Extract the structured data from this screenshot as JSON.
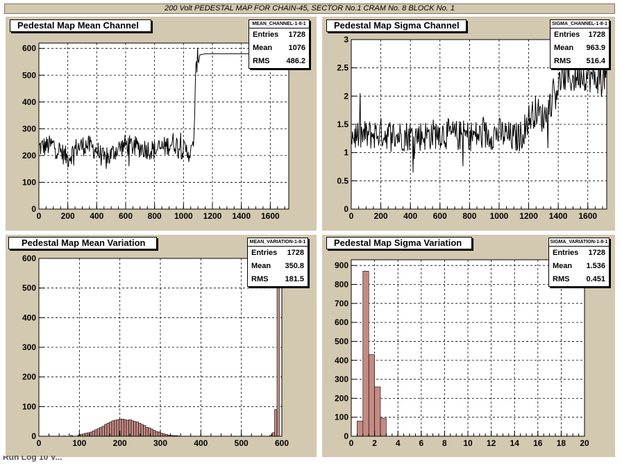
{
  "header": {
    "title": "200 Volt PEDESTAL MAP FOR CHAIN-45, SECTOR No.1 CRAM No. 8 BLOCK No. 1"
  },
  "footer": {
    "text": "Run Log 10 V..."
  },
  "colors": {
    "pad": "#d3c8b0",
    "hist_fill": "#c48b84",
    "line": "#000000"
  },
  "chart_data": [
    {
      "type": "line",
      "title": "Pedestal Map Mean Channel",
      "stats": {
        "name": "MEAN_CHANNEL-1-8-1",
        "Entries": "1728",
        "Mean": "1076",
        "RMS": "486.2"
      },
      "xlim": [
        0,
        1728
      ],
      "ylim": [
        0,
        620
      ],
      "xticks": [
        0,
        200,
        400,
        600,
        800,
        1000,
        1200,
        1400,
        1600
      ],
      "yticks": [
        0,
        100,
        200,
        300,
        400,
        500,
        600
      ],
      "grid": true,
      "series": [
        {
          "x": [
            0,
            100,
            200,
            260,
            330,
            400,
            460,
            530,
            600,
            700,
            800,
            860,
            930,
            1000,
            1060,
            1075,
            1085,
            1095,
            1105,
            1150,
            1300,
            1400,
            1500,
            1600,
            1728
          ],
          "y": [
            230,
            240,
            190,
            230,
            240,
            220,
            180,
            220,
            240,
            230,
            220,
            230,
            250,
            220,
            210,
            300,
            500,
            560,
            575,
            580,
            580,
            580,
            580,
            580,
            580
          ]
        }
      ]
    },
    {
      "type": "line",
      "title": "Pedestal Map Sigma Channel",
      "stats": {
        "name": "SIGMA_CHANNEL-1-8-1",
        "Entries": "1728",
        "Mean": "963.9",
        "RMS": "516.4"
      },
      "xlim": [
        0,
        1728
      ],
      "ylim": [
        0,
        3
      ],
      "xticks": [
        0,
        200,
        400,
        600,
        800,
        1000,
        1200,
        1400,
        1600
      ],
      "yticks": [
        0,
        0.5,
        1,
        1.5,
        2,
        2.5,
        3
      ],
      "ytick_labels": [
        "0",
        "0.5",
        "1",
        "1.5",
        "2",
        "2.5",
        "3"
      ],
      "grid": true,
      "series": [
        {
          "x": [
            0,
            100,
            200,
            300,
            400,
            500,
            600,
            700,
            800,
            900,
            1000,
            1100,
            1150,
            1200,
            1250,
            1300,
            1350,
            1400,
            1450,
            1500,
            1550,
            1600,
            1650,
            1728
          ],
          "y": [
            1.3,
            1.3,
            1.35,
            1.3,
            1.3,
            1.3,
            1.35,
            1.3,
            1.3,
            1.3,
            1.35,
            1.25,
            1.3,
            1.6,
            1.75,
            1.6,
            1.9,
            2.2,
            2.35,
            2.3,
            2.4,
            2.35,
            2.3,
            2.35
          ]
        }
      ]
    },
    {
      "type": "bar",
      "title": "Pedestal Map Mean Variation",
      "stats": {
        "name": "MEAN_VARIATION-1-8-1",
        "Entries": "1728",
        "Mean": "350.8",
        "RMS": "181.5"
      },
      "xlim": [
        0,
        600
      ],
      "ylim": [
        0,
        600
      ],
      "xticks": [
        0,
        100,
        200,
        300,
        400,
        500,
        600
      ],
      "yticks": [
        0,
        100,
        200,
        300,
        400,
        500,
        600
      ],
      "grid": true,
      "bin_width": 6,
      "bin_starts": [
        60,
        78,
        96,
        102,
        108,
        114,
        120,
        126,
        132,
        138,
        144,
        150,
        156,
        162,
        168,
        174,
        180,
        186,
        192,
        198,
        204,
        210,
        216,
        222,
        228,
        234,
        240,
        246,
        252,
        258,
        264,
        270,
        276,
        282,
        288,
        294,
        300,
        306,
        312,
        318,
        324,
        330,
        336,
        342,
        570,
        576,
        582,
        588
      ],
      "values": [
        1,
        2,
        4,
        6,
        8,
        10,
        12,
        14,
        18,
        22,
        26,
        30,
        34,
        40,
        44,
        48,
        52,
        54,
        56,
        58,
        58,
        56,
        54,
        56,
        52,
        50,
        48,
        44,
        40,
        36,
        30,
        28,
        24,
        20,
        16,
        14,
        10,
        8,
        6,
        4,
        3,
        2,
        2,
        1,
        3,
        12,
        90,
        590
      ]
    },
    {
      "type": "bar",
      "title": "Pedestal Map Sigma Variation",
      "stats": {
        "name": "SIGMA_VARIATION-1-8-1",
        "Entries": "1728",
        "Mean": "1.536",
        "RMS": "0.451"
      },
      "xlim": [
        0,
        20
      ],
      "ylim": [
        0,
        930
      ],
      "xticks": [
        0,
        2,
        4,
        6,
        8,
        10,
        12,
        14,
        16,
        18,
        20
      ],
      "yticks": [
        0,
        100,
        200,
        300,
        400,
        500,
        600,
        700,
        800,
        900
      ],
      "grid": true,
      "bin_width": 0.5,
      "bin_starts": [
        0.5,
        1.0,
        1.5,
        2.0,
        2.5
      ],
      "values": [
        80,
        870,
        430,
        260,
        95
      ]
    }
  ]
}
